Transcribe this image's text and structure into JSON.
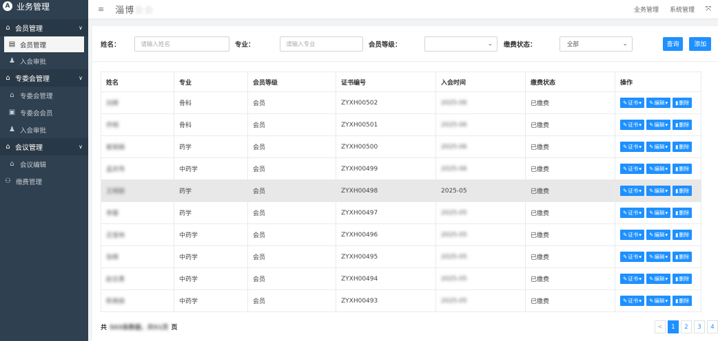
{
  "sidebar": {
    "brand": "业务管理",
    "groups": [
      {
        "label": "会员管理",
        "items": [
          "会员管理",
          "入会审批"
        ]
      },
      {
        "label": "专委会管理",
        "items": [
          "专委会管理",
          "专委会会员",
          "入会审批"
        ]
      },
      {
        "label": "会议管理",
        "items": [
          "会议编辑"
        ]
      }
    ],
    "top_item": "缴费管理"
  },
  "header": {
    "org_name_visible": "淄博",
    "org_name_blurred": "会会",
    "links": [
      "业务管理",
      "系统管理"
    ]
  },
  "filters": {
    "name_label": "姓名：",
    "name_placeholder": "请输入姓名",
    "major_label": "专业：",
    "major_placeholder": "请输入专业",
    "level_label": "会员等级：",
    "level_value": "",
    "status_label": "缴费状态：",
    "status_value": "全部",
    "search_label": "查询",
    "add_label": "添加"
  },
  "table": {
    "headers": [
      "姓名",
      "专业",
      "会员等级",
      "证书编号",
      "入会时间",
      "缴费状态",
      "操作"
    ],
    "rows": [
      {
        "name": "刘辉",
        "major": "骨科",
        "level": "会员",
        "cert": "ZYXH00502",
        "date": "2025-06",
        "status": "已缴费"
      },
      {
        "name": "乔明",
        "major": "骨科",
        "level": "会员",
        "cert": "ZYXH00501",
        "date": "2025-06",
        "status": "已缴费"
      },
      {
        "name": "崔丽娟",
        "major": "药学",
        "level": "会员",
        "cert": "ZYXH00500",
        "date": "2025-06",
        "status": "已缴费"
      },
      {
        "name": "孟庆伟",
        "major": "中药学",
        "level": "会员",
        "cert": "ZYXH00499",
        "date": "2025-06",
        "status": "已缴费"
      },
      {
        "name": "王明丽",
        "major": "药学",
        "level": "会员",
        "cert": "ZYXH00498",
        "date": "2025-05",
        "status": "已缴费"
      },
      {
        "name": "李霞",
        "major": "药学",
        "level": "会员",
        "cert": "ZYXH00497",
        "date": "2025-05",
        "status": "已缴费"
      },
      {
        "name": "吕宝林",
        "major": "中药学",
        "level": "会员",
        "cert": "ZYXH00496",
        "date": "2025-05",
        "status": "已缴费"
      },
      {
        "name": "张辉",
        "major": "中药学",
        "level": "会员",
        "cert": "ZYXH00495",
        "date": "2025-05",
        "status": "已缴费"
      },
      {
        "name": "赵志勇",
        "major": "中药学",
        "level": "会员",
        "cert": "ZYXH00494",
        "date": "2025-05",
        "status": "已缴费"
      },
      {
        "name": "陈艳丽",
        "major": "中药学",
        "level": "会员",
        "cert": "ZYXH00493",
        "date": "2025-05",
        "status": "已缴费"
      }
    ],
    "highlight_row": 4,
    "clear_date_row": 4,
    "op_labels": {
      "cert": "证书",
      "edit": "编辑",
      "delete": "删除"
    }
  },
  "footer": {
    "prefix": "共",
    "blurred_count": "503条数据，共51页",
    "suffix": "页"
  },
  "pagination": {
    "prev": "<",
    "pages": [
      "1",
      "2",
      "3",
      "4"
    ],
    "current": "1"
  },
  "colors": {
    "primary": "#1e90ff",
    "sidebar": "#2f4050"
  }
}
